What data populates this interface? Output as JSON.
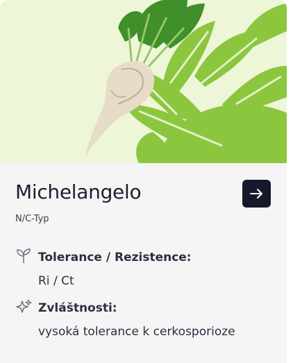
{
  "product": {
    "name": "Michelangelo",
    "type": "N/C-Typ"
  },
  "details": [
    {
      "icon": "seedling-icon",
      "label": "Tolerance / Rezistence:",
      "value": "Ri / Ct"
    },
    {
      "icon": "sparkles-icon",
      "label": "Zvláštnosti:",
      "value": "vysoká tolerance k cerkosporioze"
    }
  ],
  "colors": {
    "hero_background": "#eef6d8",
    "leaf_green": "#8cc63f",
    "card_background": "#f5f5f5",
    "button_background": "#141a2b",
    "text_dark": "#1a1f2e"
  }
}
